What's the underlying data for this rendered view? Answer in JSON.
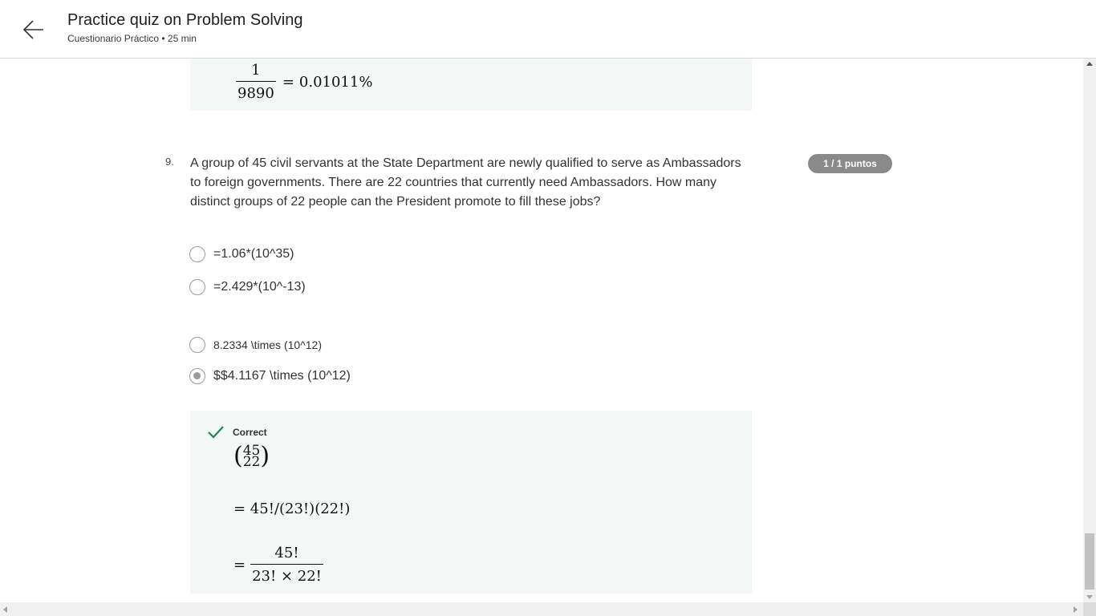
{
  "header": {
    "back_icon": "arrow-left-icon",
    "title": "Practice quiz on Problem Solving",
    "subtitle": "Cuestionario Práctico • 25 min"
  },
  "previous_feedback": {
    "numerator": "1",
    "denominator": "9890",
    "equals": "=",
    "result": "0.01011%"
  },
  "question": {
    "number": "9.",
    "text": "A group of 45 civil servants at the State Department are newly qualified to serve as Ambassadors to foreign governments. There are 22 countries that currently need Ambassadors. How many distinct groups of 22 people can the President promote to fill these jobs?",
    "points": "1 / 1 puntos",
    "options": [
      {
        "label": "=1.06*(10^35)",
        "selected": false
      },
      {
        "label": "=2.429*(10^-13)",
        "selected": false
      },
      {
        "label": "8.2334 \\times (10^12)",
        "selected": false
      },
      {
        "label": "$$4.1167 \\times (10^12)",
        "selected": true
      }
    ]
  },
  "feedback": {
    "status_icon": "check-icon",
    "status": "Correct",
    "status_color": "#1f8354",
    "binom_top": "45",
    "binom_bottom": "22",
    "line2": "= 45!/(23!)(22!)",
    "line3_equals": "=",
    "line3_numerator": "45!",
    "line3_denominator": "23! × 22!"
  },
  "colors": {
    "feedback_bg": "#f3f8f6",
    "badge_bg": "#8a8a8a"
  }
}
